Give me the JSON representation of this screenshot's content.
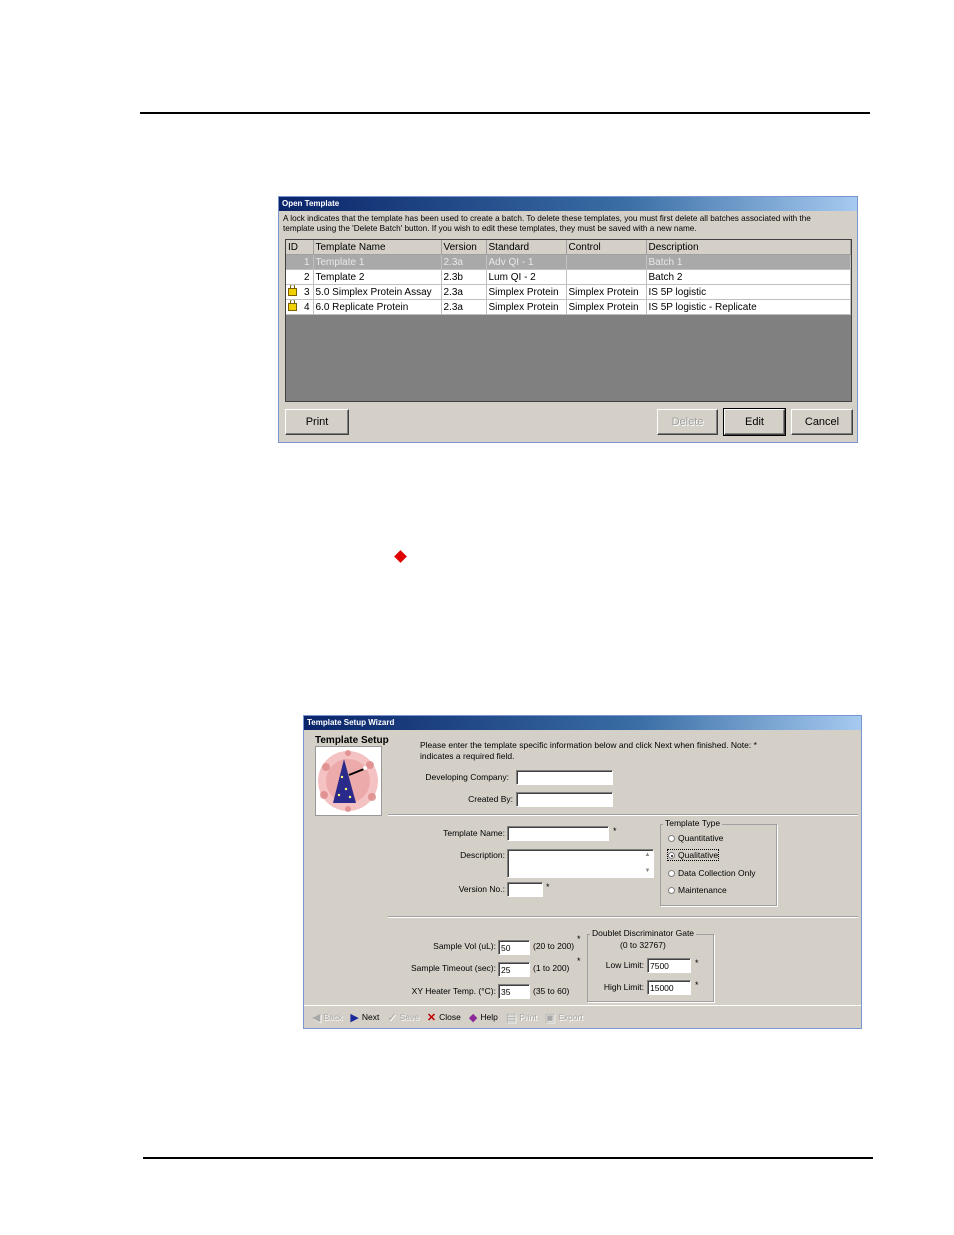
{
  "open_template": {
    "title": "Open Template",
    "note_line1": "A lock indicates that the template has been used to create a batch.  To delete these templates, you must first delete all batches associated with the",
    "note_line2": "template using the 'Delete Batch' button.  If you wish to edit these templates, they must be saved with a new name.",
    "columns": [
      "ID",
      "Template Name",
      "Version",
      "Standard",
      "Control",
      "Description"
    ],
    "rows": [
      {
        "locked": false,
        "id": "1",
        "name": "Template 1",
        "version": "2.3a",
        "standard": "Adv QI - 1",
        "control": "",
        "description": "Batch 1",
        "selected": true
      },
      {
        "locked": false,
        "id": "2",
        "name": "Template 2",
        "version": "2.3b",
        "standard": "Lum QI - 2",
        "control": "",
        "description": "Batch 2",
        "selected": false
      },
      {
        "locked": true,
        "id": "3",
        "name": "5.0 Simplex Protein Assay",
        "version": "2.3a",
        "standard": "Simplex Protein",
        "control": "Simplex Protein",
        "description": "IS 5P logistic",
        "selected": false
      },
      {
        "locked": true,
        "id": "4",
        "name": "6.0 Replicate Protein",
        "version": "2.3a",
        "standard": "Simplex Protein",
        "control": "Simplex Protein",
        "description": "IS 5P logistic - Replicate",
        "selected": false
      }
    ],
    "buttons": {
      "print": "Print",
      "delete": "Delete",
      "edit": "Edit",
      "cancel": "Cancel"
    }
  },
  "wizard": {
    "title": "Template Setup Wizard",
    "section_title": "Template Setup",
    "instructions_line1": "Please enter the template specific information below and click Next when finished.  Note: *",
    "instructions_line2": "indicates a required field.",
    "developing_company_label": "Developing Company:",
    "developing_company_value": "",
    "created_by_label": "Created By:",
    "created_by_value": "",
    "template_name_label": "Template Name:",
    "template_name_value": "",
    "description_label": "Description:",
    "description_value": "",
    "version_label": "Version No.:",
    "version_value": "",
    "required_mark": "*",
    "template_type": {
      "title": "Template Type",
      "options": [
        "Quantitative",
        "Qualitative",
        "Data Collection Only",
        "Maintenance"
      ],
      "selected": "Qualitative"
    },
    "sample_vol_label": "Sample Vol (uL):",
    "sample_vol_value": "50",
    "sample_vol_range": "(20 to 200)",
    "sample_timeout_label": "Sample Timeout (sec):",
    "sample_timeout_value": "25",
    "sample_timeout_range": "(1 to 200)",
    "heater_label": "XY Heater Temp. (°C):",
    "heater_value": "35",
    "heater_range": "(35 to 60)",
    "doublet": {
      "title": "Doublet Discriminator Gate",
      "range": "(0 to 32767)",
      "low_label": "Low Limit:",
      "low_value": "7500",
      "high_label": "High Limit:",
      "high_value": "15000"
    },
    "toolbar": {
      "back": "Back",
      "next": "Next",
      "save": "Save",
      "close": "Close",
      "help": "Help",
      "print": "Print",
      "export": "Export"
    }
  }
}
